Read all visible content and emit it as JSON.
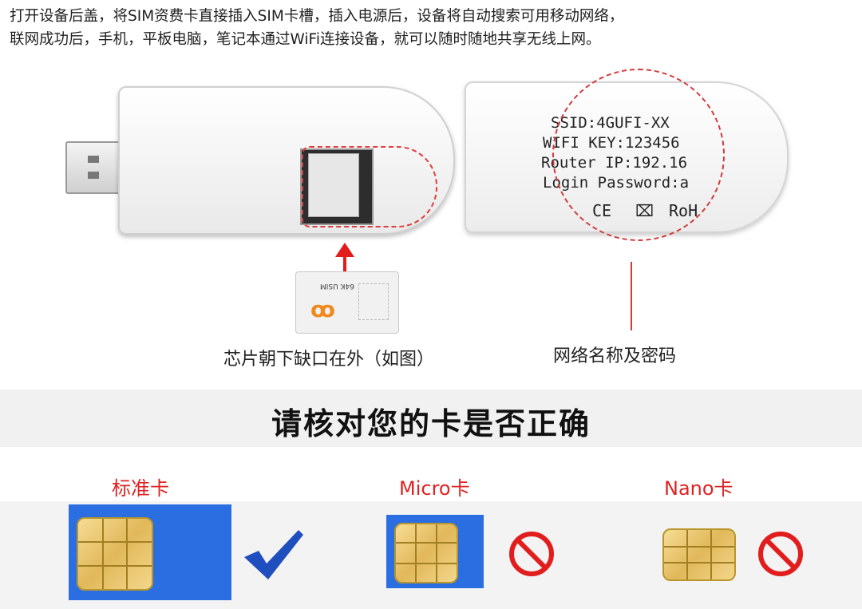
{
  "intro": {
    "line1": "打开设备后盖，将SIM资费卡直接插入SIM卡槽，插入电源后，设备将自动搜索可用移动网络，",
    "line2": "联网成功后，手机，平板电脑，笔记本通过WiFi连接设备，就可以随时随地共享无线上网。"
  },
  "device": {
    "label_lines": [
      "SSID:4GUFI-XX",
      "WIFI KEY:123456",
      "Router IP:192.16",
      "Login Password:a"
    ],
    "marks": [
      "CE",
      "RoH"
    ],
    "sim_tag": "64K USIM"
  },
  "captions": {
    "left": "芯片朝下缺口在外（如图）",
    "right": "网络名称及密码"
  },
  "heading": "请核对您的卡是否正确",
  "cards": [
    {
      "title": "标准卡",
      "status": "check-icon"
    },
    {
      "title": "Micro卡",
      "status": "forbidden-icon"
    },
    {
      "title": "Nano卡",
      "status": "forbidden-icon"
    }
  ],
  "colors": {
    "accent_red": "#e02222",
    "card_blue": "#2a6ee2",
    "check_blue": "#1f4fbf"
  }
}
